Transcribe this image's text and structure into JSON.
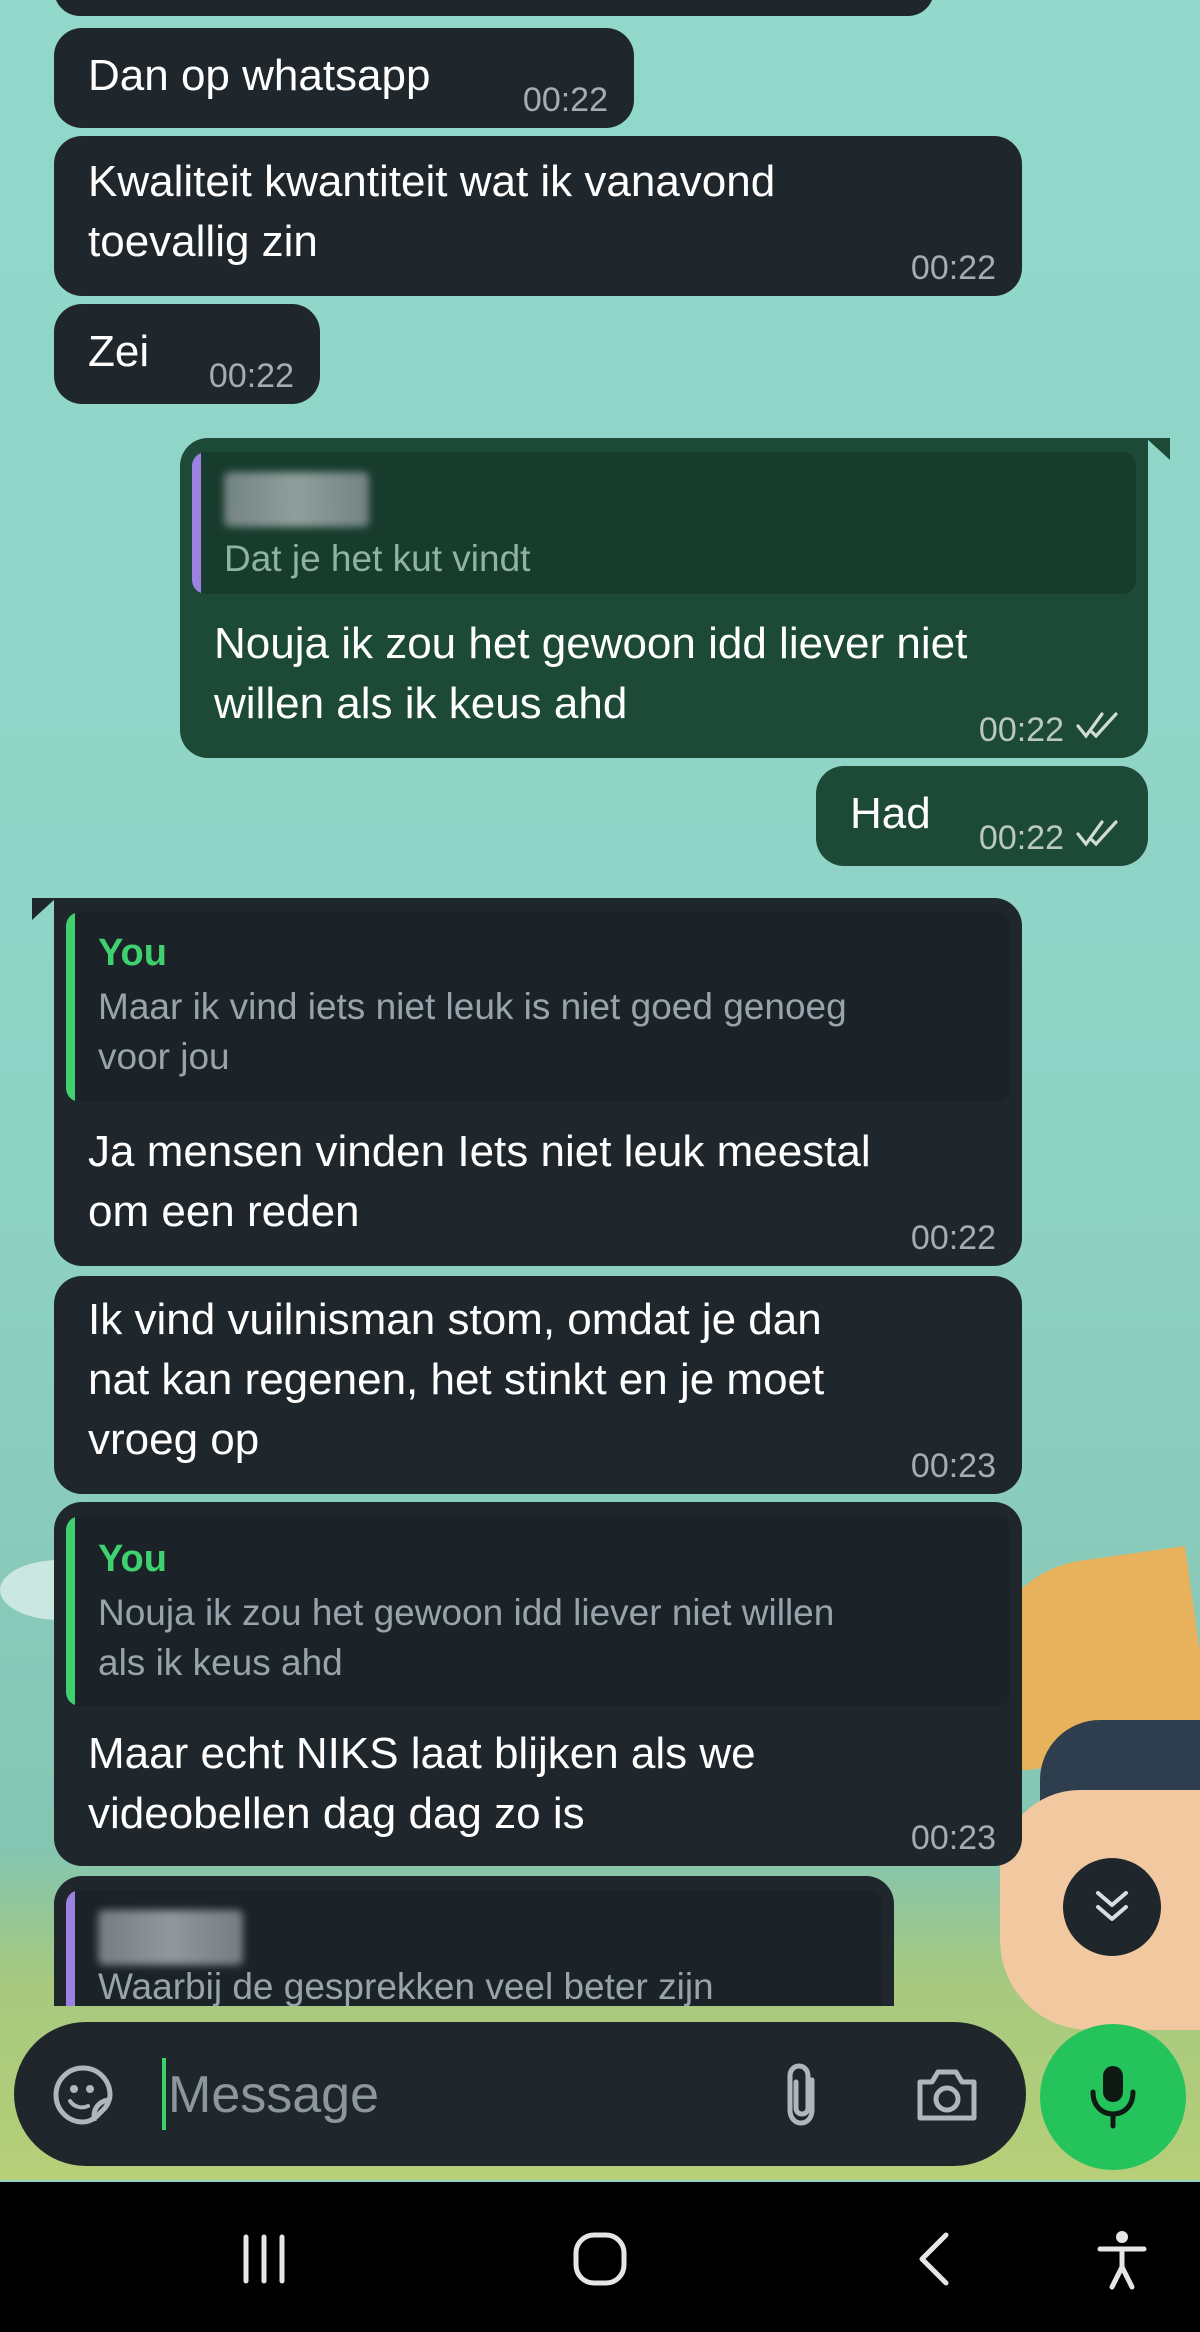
{
  "messages": [
    {
      "id": "m1",
      "dir": "in",
      "text": "Dan op whatsapp",
      "time": "00:22"
    },
    {
      "id": "m2",
      "dir": "in",
      "text": "Kwaliteit kwantiteit wat ik vanavond\ntoevallig zin",
      "time": "00:22"
    },
    {
      "id": "m3",
      "dir": "in",
      "text": "Zei",
      "time": "00:22"
    },
    {
      "id": "m4",
      "dir": "out",
      "quote": {
        "author": "",
        "text": "Dat je het kut vindt"
      },
      "text": "Nouja ik zou het gewoon idd liever niet\nwillen als ik keus ahd",
      "time": "00:22"
    },
    {
      "id": "m5",
      "dir": "out",
      "text": "Had",
      "time": "00:22"
    },
    {
      "id": "m6",
      "dir": "in",
      "quote": {
        "author": "You",
        "text": "Maar ik vind iets niet leuk is niet goed genoeg\nvoor jou"
      },
      "text": "Ja mensen vinden Iets niet leuk meestal\nom een reden",
      "time": "00:22"
    },
    {
      "id": "m7",
      "dir": "in",
      "text": "Ik vind vuilnisman stom, omdat je dan\nnat kan regenen, het stinkt en je moet\nvroeg op",
      "time": "00:23"
    },
    {
      "id": "m8",
      "dir": "in",
      "quote": {
        "author": "You",
        "text": "Nouja ik zou het gewoon idd liever niet willen\nals ik keus ahd"
      },
      "text": "Maar echt NIKS laat blijken als we\nvideobellen dag dag zo is",
      "time": "00:23"
    },
    {
      "id": "m9",
      "dir": "in",
      "quote": {
        "author": "",
        "text": "Waarbij de gesprekken veel beter zijn"
      }
    }
  ],
  "composer": {
    "placeholder": "Message"
  },
  "colors": {
    "incoming": "#1f272d",
    "outgoing": "#1d4a37",
    "accent": "#24c35b",
    "quote_in": "#3fd16f",
    "quote_out": "#9b82e0"
  },
  "icons": {
    "scroll": "double-chevron-down-icon",
    "emoji": "sticker-icon",
    "attach": "paperclip-icon",
    "camera": "camera-icon",
    "mic": "microphone-icon",
    "nav": [
      "recent-apps-icon",
      "home-icon",
      "back-icon",
      "accessibility-icon"
    ]
  }
}
